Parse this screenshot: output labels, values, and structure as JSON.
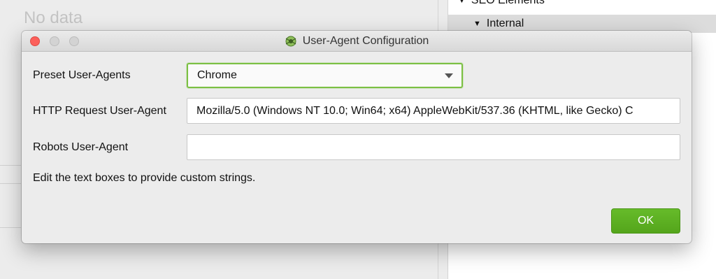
{
  "background": {
    "no_data_text": "No data",
    "tree": {
      "row1_label": "SEO Elements",
      "row2_label": "Internal"
    }
  },
  "dialog": {
    "title": "User-Agent Configuration",
    "preset_label": "Preset User-Agents",
    "preset_selected": "Chrome",
    "http_label": "HTTP Request User-Agent",
    "http_value": "Mozilla/5.0 (Windows NT 10.0; Win64; x64) AppleWebKit/537.36 (KHTML, like Gecko) C",
    "robots_label": "Robots User-Agent",
    "robots_value": "",
    "hint": "Edit the text boxes to provide custom strings.",
    "ok_label": "OK"
  },
  "colors": {
    "accent_green": "#5cb021",
    "close_red": "#fc605b"
  },
  "icons": {
    "title_icon": "spider-icon",
    "dropdown_icon": "chevron-down-icon"
  }
}
